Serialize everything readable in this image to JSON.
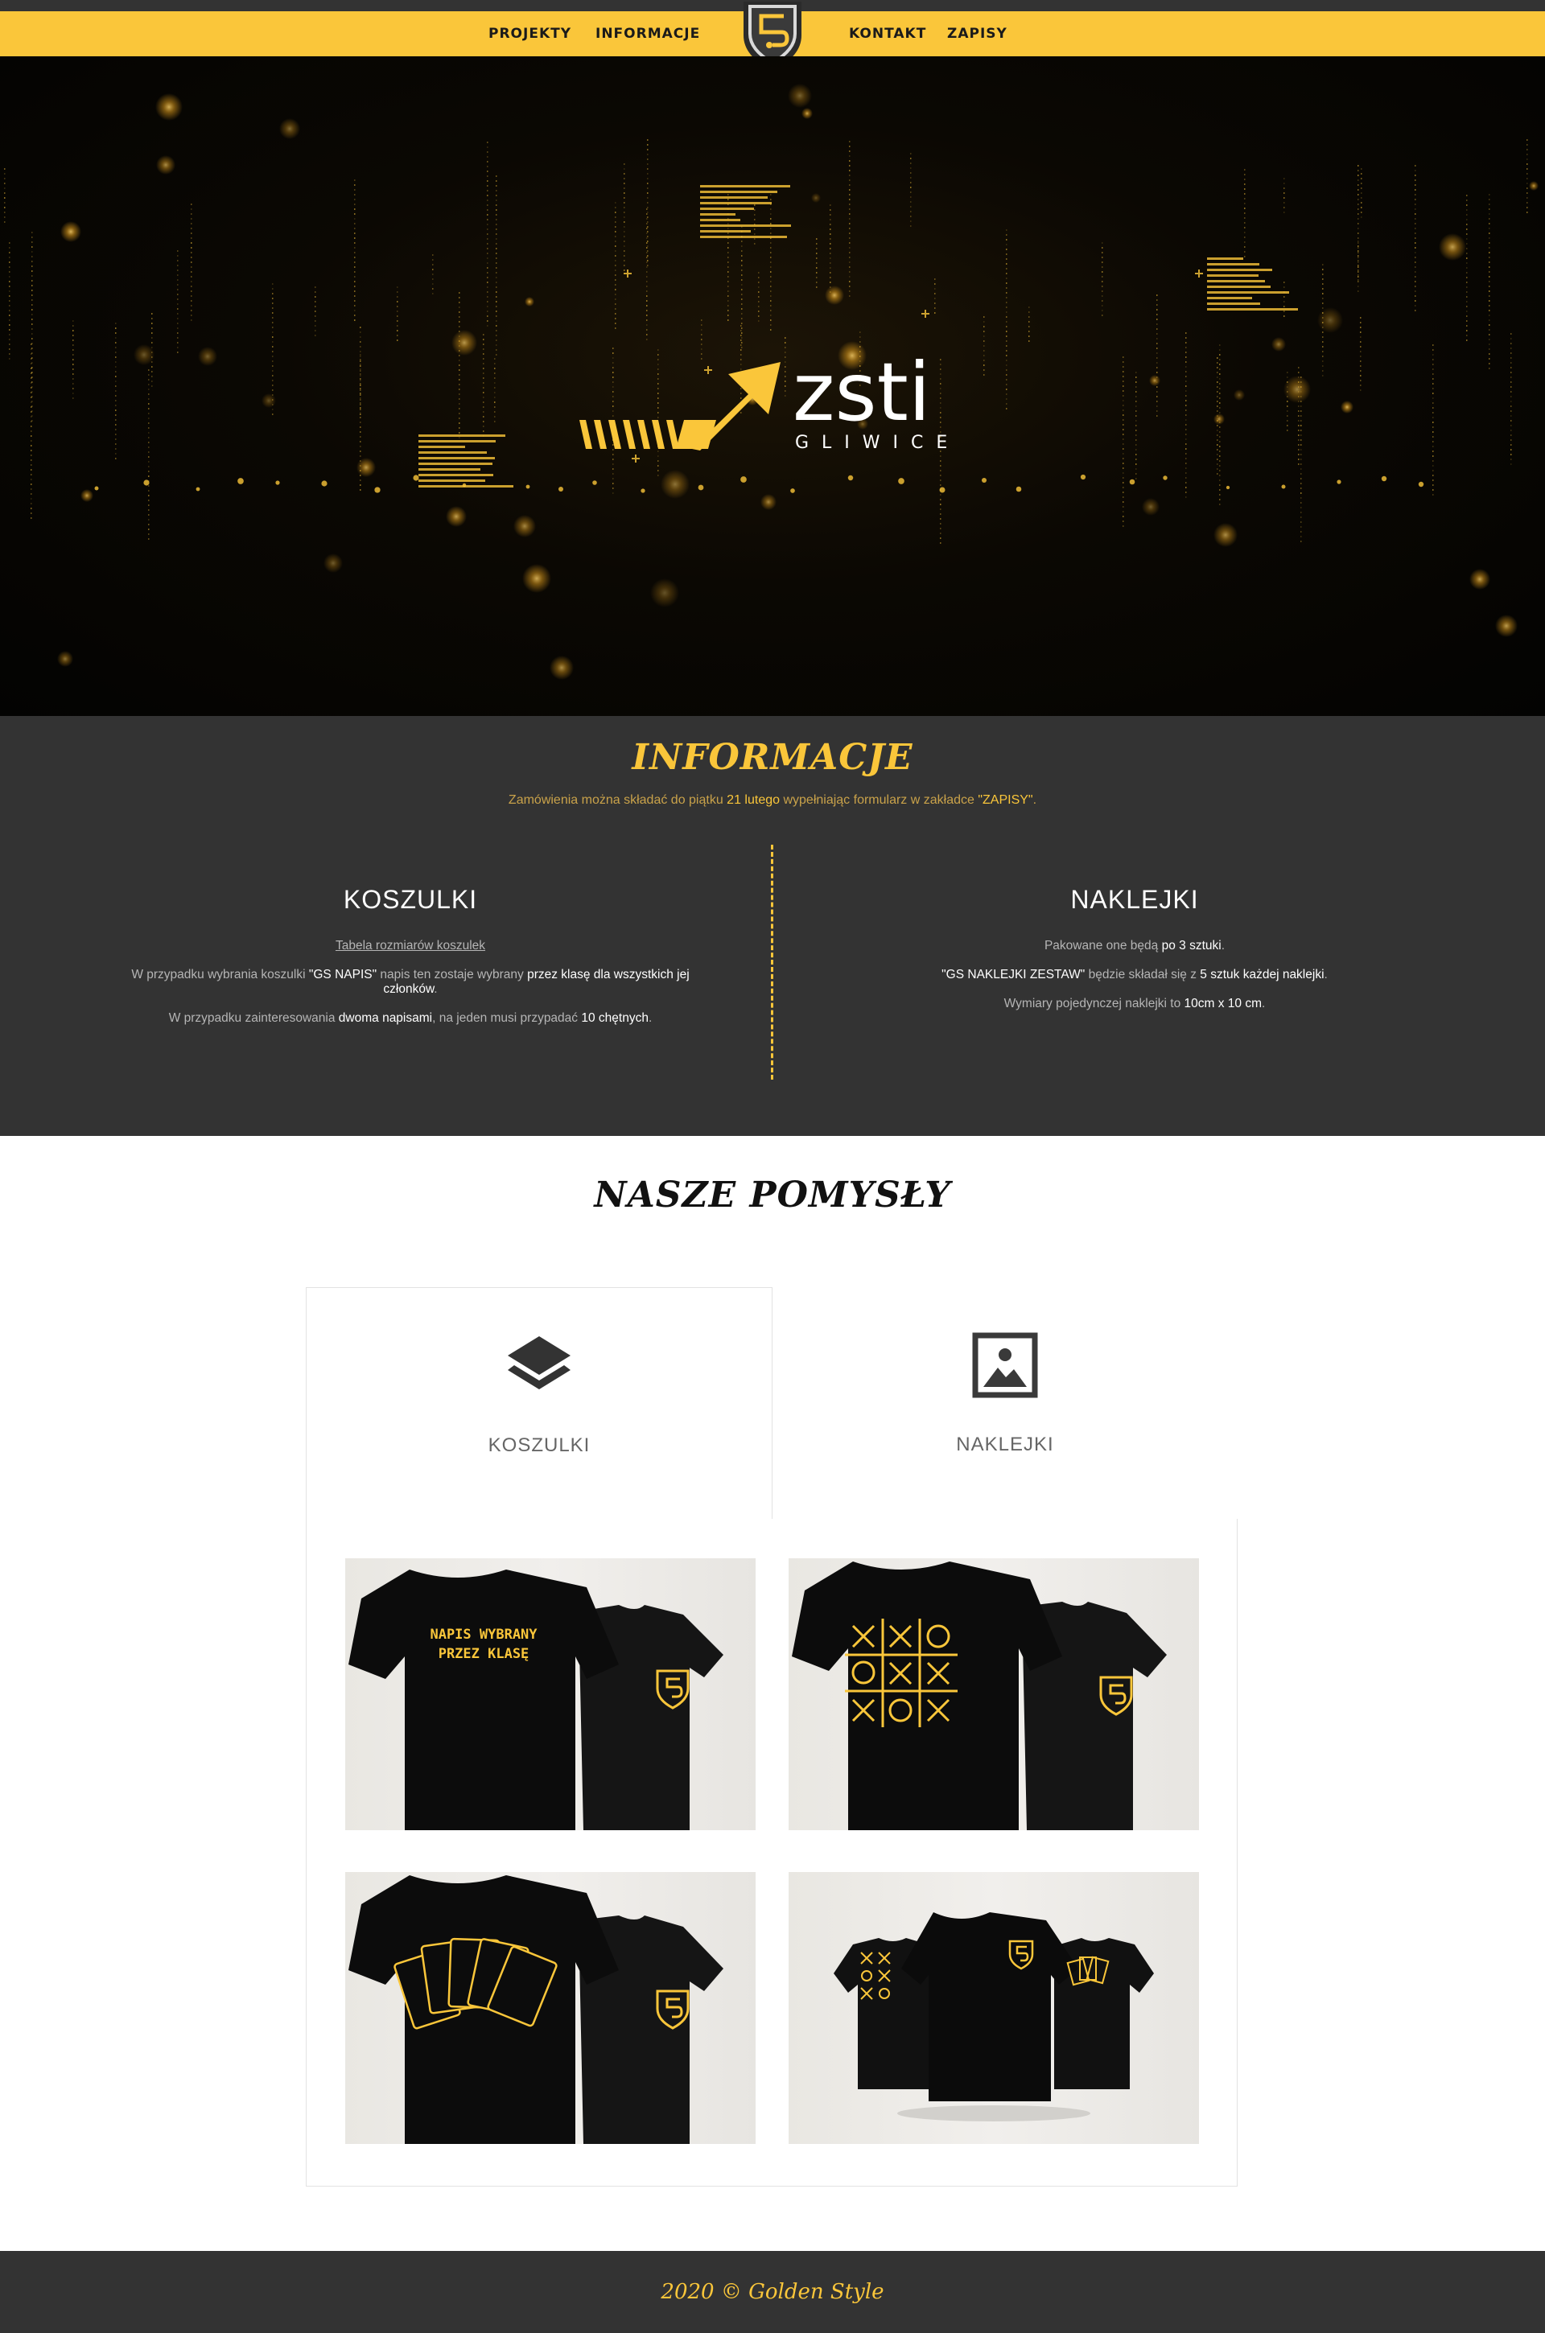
{
  "nav": {
    "links": [
      "PROJEKTY",
      "INFORMACJE",
      "KONTAKT",
      "ZAPISY"
    ],
    "logo_icon": "golden-style-shield-logo"
  },
  "hero": {
    "logo_main": "zsti",
    "logo_sub": "GLIWICE",
    "logo_icon": "arrow-up-right-icon"
  },
  "info": {
    "title": "INFORMACJE",
    "notice": {
      "before": "Zamówienia można składać do piątku ",
      "date": "21 lutego",
      "middle": " wypełniając formularz w zakładce ",
      "tab": "\"ZAPISY\"",
      "end": "."
    },
    "koszulki": {
      "title": "KOSZULKI",
      "size_link": "Tabela rozmiarów koszulek",
      "p1_a": "W przypadku wybrania koszulki ",
      "p1_b": "\"GS NAPIS\"",
      "p1_c": " napis ten zostaje wybrany ",
      "p1_d": "przez klasę dla wszystkich jej",
      "p1_e": "członków",
      "p1_f": ".",
      "p2_a": "W przypadku zainteresowania ",
      "p2_b": "dwoma napisami",
      "p2_c": ", na jeden musi przypadać ",
      "p2_d": "10 chętnych",
      "p2_e": "."
    },
    "naklejki": {
      "title": "NAKLEJKI",
      "p1_a": "Pakowane one będą ",
      "p1_b": "po 3 sztuki",
      "p1_c": ".",
      "p2_a": "\"GS NAKLEJKI ZESTAW\"",
      "p2_b": " będzie składał się z ",
      "p2_c": "5 sztuk każdej naklejki",
      "p2_d": ".",
      "p3_a": "Wymiary pojedynczej naklejki to ",
      "p3_b": "10cm x 10 cm",
      "p3_c": "."
    }
  },
  "ideas": {
    "title": "NASZE POMYSŁY",
    "tabs": [
      {
        "label": "KOSZULKI",
        "icon": "layers-icon",
        "active": true
      },
      {
        "label": "NAKLEJKI",
        "icon": "image-frame-icon",
        "active": false
      }
    ],
    "shirts": [
      {
        "name": "shirt-napis",
        "print": [
          "NAPIS WYBRANY",
          "PRZEZ KLASĘ"
        ]
      },
      {
        "name": "shirt-tic-tac-toe",
        "print": []
      },
      {
        "name": "shirt-cards",
        "print": []
      },
      {
        "name": "shirt-set",
        "print": []
      }
    ]
  },
  "footer": {
    "text": "2020 © Golden Style"
  },
  "colors": {
    "accent": "#fac63a",
    "dark": "#333333",
    "hero_bg": "#050403"
  }
}
